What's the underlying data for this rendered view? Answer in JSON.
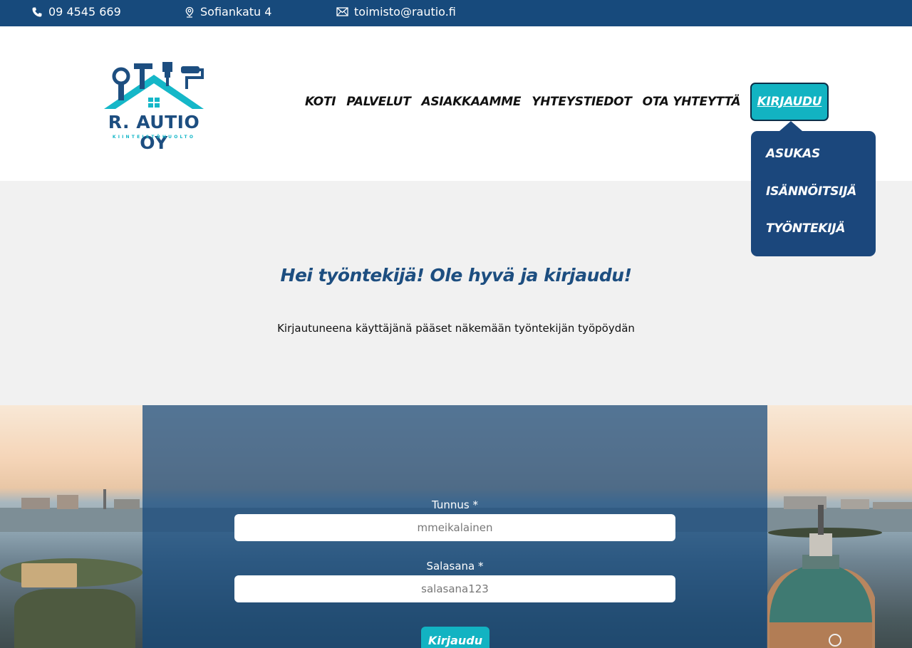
{
  "topbar": {
    "phone": "09 4545 669",
    "address": "Sofiankatu 4",
    "email": "toimisto@rautio.fi",
    "icons": [
      "phone-icon",
      "location-pin-icon",
      "envelope-icon"
    ]
  },
  "logo": {
    "name": "R. AUTIO OY",
    "subtitle": "KIINTEISTÖHUOLTO"
  },
  "nav": {
    "items": [
      "KOTI",
      "PALVELUT",
      "ASIAKKAAMME",
      "YHTEYSTIEDOT",
      "OTA YHTEYTTÄ"
    ],
    "active": "KIRJAUDU",
    "dropdown": [
      "ASUKAS",
      "ISÄNNÖITSIJÄ",
      "TYÖNTEKIJÄ"
    ]
  },
  "intro": {
    "title": "Hei työntekijä! Ole hyvä ja kirjaudu!",
    "text": "Kirjautuneena käyttäjänä pääset näkemään työntekijän työpöydän"
  },
  "form": {
    "username_label": "Tunnus *",
    "username_value": "mmeikalainen",
    "password_label": "Salasana *",
    "password_value": "salasana123",
    "submit_label": "Kirjaudu"
  },
  "colors": {
    "primary": "#174a7c",
    "accent": "#12b3c2",
    "background_light": "#f1f1f1"
  }
}
